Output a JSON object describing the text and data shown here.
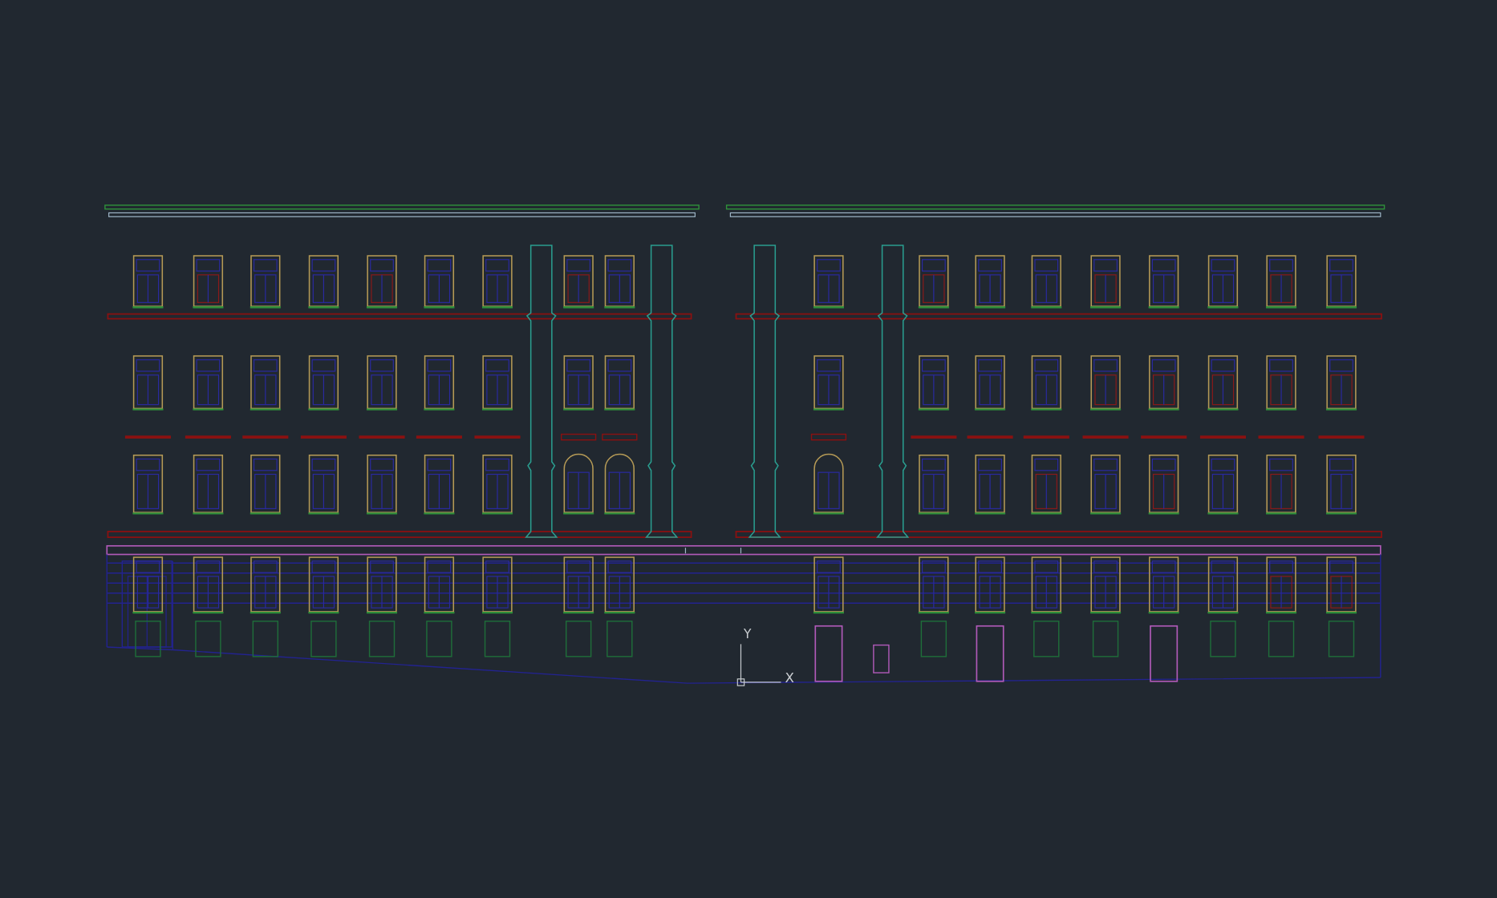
{
  "ucs_icon": {
    "x_label": "X",
    "y_label": "Y"
  }
}
